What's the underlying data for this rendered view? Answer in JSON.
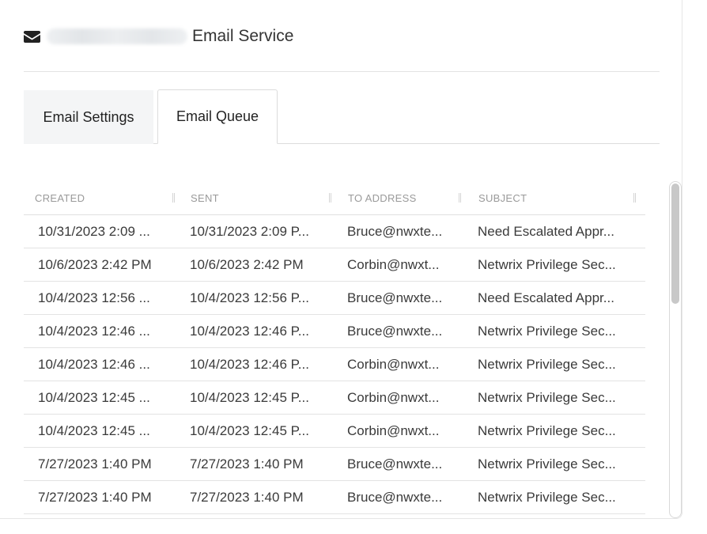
{
  "header": {
    "icon": "envelope-icon",
    "title": "Email Service"
  },
  "tabs": [
    {
      "label": "Email Settings",
      "active": false
    },
    {
      "label": "Email Queue",
      "active": true
    }
  ],
  "table": {
    "columns": [
      "CREATED",
      "SENT",
      "TO ADDRESS",
      "SUBJECT"
    ],
    "rows": [
      [
        "10/31/2023 2:09 ...",
        "10/31/2023 2:09 P...",
        "Bruce@nwxte...",
        "Need Escalated Appr..."
      ],
      [
        "10/6/2023 2:42 PM",
        "10/6/2023 2:42 PM",
        "Corbin@nwxt...",
        "Netwrix Privilege Sec..."
      ],
      [
        "10/4/2023 12:56 ...",
        "10/4/2023 12:56 P...",
        "Bruce@nwxte...",
        "Need Escalated Appr..."
      ],
      [
        "10/4/2023 12:46 ...",
        "10/4/2023 12:46 P...",
        "Bruce@nwxte...",
        "Netwrix Privilege Sec..."
      ],
      [
        "10/4/2023 12:46 ...",
        "10/4/2023 12:46 P...",
        "Corbin@nwxt...",
        "Netwrix Privilege Sec..."
      ],
      [
        "10/4/2023 12:45 ...",
        "10/4/2023 12:45 P...",
        "Corbin@nwxt...",
        "Netwrix Privilege Sec..."
      ],
      [
        "10/4/2023 12:45 ...",
        "10/4/2023 12:45 P...",
        "Corbin@nwxt...",
        "Netwrix Privilege Sec..."
      ],
      [
        "7/27/2023 1:40 PM",
        "7/27/2023 1:40 PM",
        "Bruce@nwxte...",
        "Netwrix Privilege Sec..."
      ],
      [
        "7/27/2023 1:40 PM",
        "7/27/2023 1:40 PM",
        "Bruce@nwxte...",
        "Netwrix Privilege Sec..."
      ]
    ]
  },
  "colors": {
    "text": "#333333",
    "header_text": "#9a9a9a",
    "inactive_tab_bg": "#f4f5f6",
    "scroll_thumb": "#c8c8c8"
  }
}
